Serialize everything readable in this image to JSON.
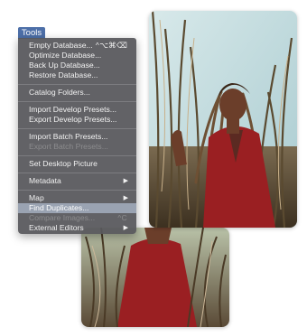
{
  "menu": {
    "title": "Tools",
    "items": [
      {
        "label": "Empty Database...",
        "shortcut": "^⌥⌘⌫"
      },
      {
        "label": "Optimize Database..."
      },
      {
        "label": "Back Up Database..."
      },
      {
        "label": "Restore Database..."
      },
      {
        "label": "Catalog Folders..."
      },
      {
        "label": "Import Develop Presets..."
      },
      {
        "label": "Export Develop Presets..."
      },
      {
        "label": "Import Batch Presets..."
      },
      {
        "label": "Export Batch Presets...",
        "state": "disabled"
      },
      {
        "label": "Set Desktop Picture"
      },
      {
        "label": "Metadata",
        "submenu": "▶"
      },
      {
        "label": "Map",
        "submenu": "▶"
      },
      {
        "label": "Find Duplicates...",
        "state": "highlighted"
      },
      {
        "label": "Compare Images...",
        "shortcut": "^C",
        "state": "disabled"
      },
      {
        "label": "External Editors",
        "submenu": "▶"
      }
    ]
  },
  "colors": {
    "menu_background": "#58585c",
    "title_tab": "#4d6fa8",
    "highlight": "#9aa3b2",
    "dress_red": "#9a1f22"
  },
  "photos": [
    {
      "name": "portrait-photo-front"
    },
    {
      "name": "portrait-photo-back"
    }
  ]
}
